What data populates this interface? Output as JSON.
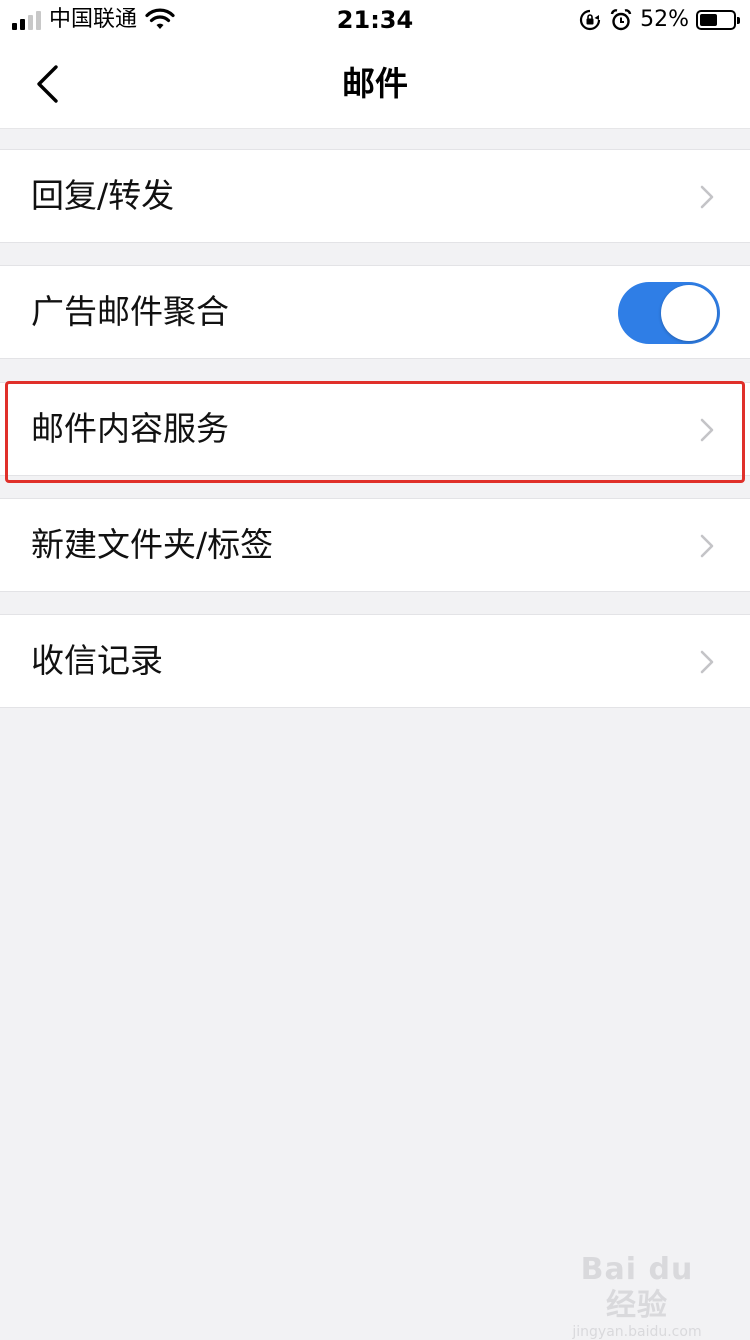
{
  "status_bar": {
    "carrier": "中国联通",
    "time": "21:34",
    "battery_percent": "52%",
    "battery_level": 0.52,
    "icons": [
      "signal-icon",
      "wifi-icon",
      "orientation-lock-icon",
      "alarm-icon",
      "battery-icon"
    ]
  },
  "nav": {
    "title": "邮件",
    "back_icon": "chevron-left-icon"
  },
  "settings": {
    "items": [
      {
        "label": "回复/转发",
        "control": "chevron"
      },
      {
        "label": "广告邮件聚合",
        "control": "toggle",
        "toggle_on": true
      },
      {
        "label": "邮件内容服务",
        "control": "chevron",
        "highlighted": true
      },
      {
        "label": "新建文件夹/标签",
        "control": "chevron"
      },
      {
        "label": "收信记录",
        "control": "chevron"
      }
    ]
  },
  "colors": {
    "accent": "#2f7ee6",
    "highlight": "#e0302a",
    "background": "#f2f2f4"
  },
  "watermark": {
    "main": "Bai du 经验",
    "sub": "jingyan.baidu.com"
  }
}
